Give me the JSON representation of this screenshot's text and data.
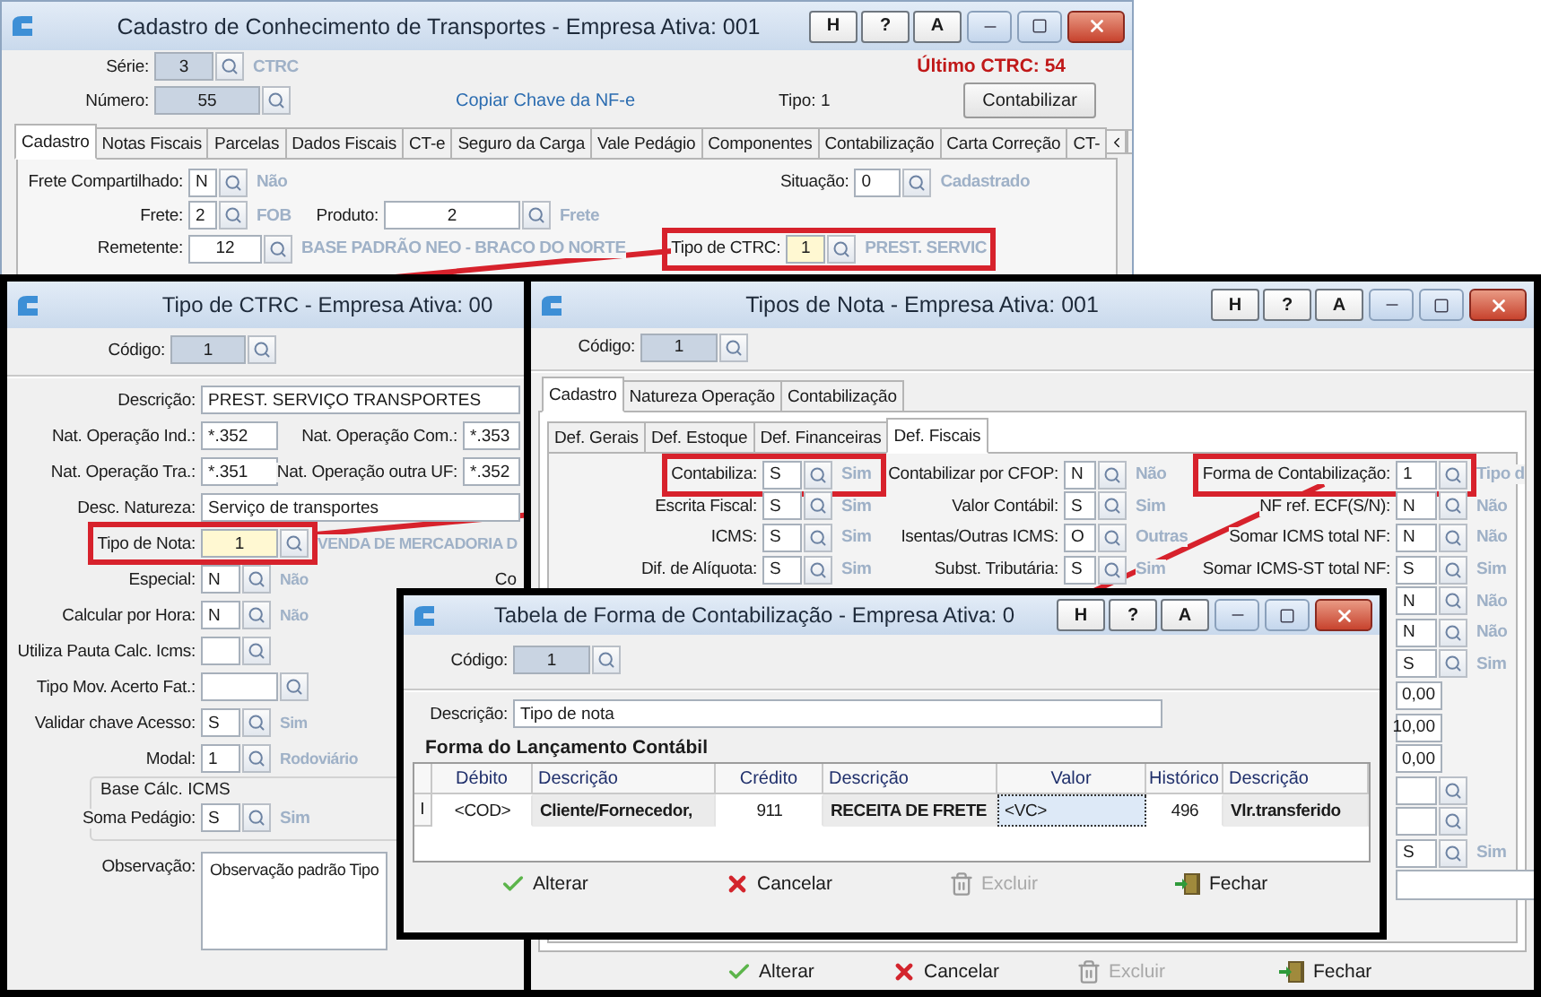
{
  "ctrc_window": {
    "title": "Cadastro de Conhecimento de Transportes - Empresa Ativa: 001",
    "title_buttons": [
      "H",
      "?",
      "A"
    ],
    "serie": {
      "label": "Série:",
      "value": "3",
      "hint": "CTRC"
    },
    "numero": {
      "label": "Número:",
      "value": "55"
    },
    "copy_link": "Copiar Chave da NF-e",
    "tipo": "Tipo: 1",
    "last_ctrc": "Último CTRC: 54",
    "contabilizar_button": "Contabilizar",
    "tabs": [
      {
        "label": "Cadastro",
        "selected": true
      },
      {
        "label": "Notas Fiscais",
        "selected": false
      },
      {
        "label": "Parcelas",
        "selected": false
      },
      {
        "label": "Dados Fiscais",
        "selected": false
      },
      {
        "label": "CT-e",
        "selected": false
      },
      {
        "label": "Seguro da Carga",
        "selected": false
      },
      {
        "label": "Vale Pedágio",
        "selected": false
      },
      {
        "label": "Componentes",
        "selected": false
      },
      {
        "label": "Contabilização",
        "selected": false
      },
      {
        "label": "Carta Correção",
        "selected": false
      },
      {
        "label": "CT-",
        "selected": false
      }
    ],
    "fields": [
      {
        "label": "Frete Compartilhado:",
        "value": "N",
        "hint": "Não",
        "focused": false,
        "highlighted": false
      },
      {
        "label": "Situação:",
        "value": "0",
        "hint": "Cadastrado",
        "focused": false,
        "highlighted": false
      },
      {
        "label": "Frete:",
        "value": "2",
        "hint": "FOB",
        "focused": false,
        "highlighted": false
      },
      {
        "label": "Produto:",
        "value": "2",
        "hint": "Frete",
        "focused": false,
        "highlighted": false
      },
      {
        "label": "Remetente:",
        "value": "12",
        "hint": "BASE PADRÃO NEO - BRACO DO NORTE",
        "focused": false,
        "highlighted": false
      },
      {
        "label": "Tipo de CTRC:",
        "value": "1",
        "hint": "PREST. SERVIC",
        "focused": true,
        "highlighted": true
      }
    ]
  },
  "tipo_ctrc_window": {
    "title": "Tipo de CTRC - Empresa Ativa: 00",
    "code": {
      "label": "Código:",
      "value": "1"
    },
    "fields": [
      {
        "kind": "text",
        "label": "Descrição:",
        "value": "PREST. SERVIÇO TRANSPORTES"
      },
      {
        "kind": "pair",
        "items": [
          {
            "label": "Nat. Operação Ind.:",
            "value": "*.352"
          },
          {
            "label": "Nat. Operação Com.:",
            "value": "*.353"
          }
        ]
      },
      {
        "kind": "pair",
        "items": [
          {
            "label": "Nat. Operação Tra.:",
            "value": "*.351"
          },
          {
            "label": "Nat. Operação outra UF:",
            "value": "*.352"
          }
        ]
      },
      {
        "kind": "text",
        "label": "Desc. Natureza:",
        "value": "Serviço de transportes"
      },
      {
        "kind": "wide_lookup",
        "label": "Tipo de Nota:",
        "value": "1",
        "hint": "VENDA DE MERCADORIA D",
        "focused": true,
        "highlighted": true
      },
      {
        "kind": "lookup",
        "label": "Especial:",
        "value": "N",
        "hint": "Não",
        "focused": false,
        "highlighted": false,
        "side_label": "Co"
      },
      {
        "kind": "lookup",
        "label": "Calcular por Hora:",
        "value": "N",
        "hint": "Não",
        "focused": false,
        "highlighted": false
      },
      {
        "kind": "lookup",
        "label": "Utiliza Pauta Calc. Icms:",
        "focused": false,
        "highlighted": false
      },
      {
        "kind": "wide_lookup",
        "label": "Tipo Mov. Acerto Fat.:",
        "focused": false,
        "highlighted": false
      },
      {
        "kind": "lookup",
        "label": "Validar chave Acesso:",
        "value": "S",
        "hint": "Sim",
        "focused": false,
        "highlighted": false
      },
      {
        "kind": "lookup",
        "label": "Modal:",
        "value": "1",
        "hint": "Rodoviário",
        "focused": false,
        "highlighted": false
      },
      {
        "kind": "group",
        "title": "Base Cálc. ICMS",
        "field": {
          "label": "Soma Pedágio:",
          "value": "S",
          "hint": "Sim",
          "focused": false,
          "highlighted": false
        }
      },
      {
        "kind": "memo",
        "label": "Observação:",
        "value": "Observação padrão Tipo"
      }
    ]
  },
  "tipos_nota_window": {
    "title": "Tipos de Nota - Empresa Ativa: 001",
    "title_buttons": [
      "H",
      "?",
      "A"
    ],
    "code": {
      "label": "Código:",
      "value": "1"
    },
    "tabs": [
      {
        "label": "Cadastro",
        "selected": true
      },
      {
        "label": "Natureza Operação",
        "selected": false
      },
      {
        "label": "Contabilização",
        "selected": false
      }
    ],
    "subtabs": [
      {
        "label": "Def. Gerais",
        "selected": false
      },
      {
        "label": "Def. Estoque",
        "selected": false
      },
      {
        "label": "Def. Financeiras",
        "selected": false
      },
      {
        "label": "Def. Fiscais",
        "selected": true
      }
    ],
    "columns": [
      [
        {
          "kind": "lookup",
          "label": "Contabiliza:",
          "value": "S",
          "hint": "Sim",
          "highlighted": true
        },
        {
          "kind": "lookup",
          "label": "Escrita Fiscal:",
          "value": "S",
          "hint": "Sim",
          "highlighted": false
        },
        {
          "kind": "lookup",
          "label": "ICMS:",
          "value": "S",
          "hint": "Sim",
          "highlighted": false
        },
        {
          "kind": "lookup",
          "label": "Dif. de Alíquota:",
          "value": "S",
          "hint": "Sim",
          "highlighted": false
        }
      ],
      [
        {
          "kind": "lookup",
          "label": "Contabilizar por CFOP:",
          "value": "N",
          "hint": "Não",
          "highlighted": false
        },
        {
          "kind": "lookup",
          "label": "Valor Contábil:",
          "value": "S",
          "hint": "Sim",
          "highlighted": false
        },
        {
          "kind": "lookup",
          "label": "Isentas/Outras ICMS:",
          "value": "O",
          "hint": "Outras",
          "highlighted": false
        },
        {
          "kind": "lookup",
          "label": "Subst. Tributária:",
          "value": "S",
          "hint": "Sim",
          "highlighted": false
        }
      ],
      [
        {
          "kind": "lookup",
          "label": "Forma de Contabilização:",
          "value": "1",
          "hint": "Tipo d",
          "highlighted": true
        },
        {
          "kind": "lookup",
          "label": "NF ref. ECF(S/N):",
          "value": "N",
          "hint": "Não",
          "highlighted": false
        },
        {
          "kind": "lookup",
          "label": "Somar ICMS total NF:",
          "value": "N",
          "hint": "Não",
          "highlighted": false
        },
        {
          "kind": "lookup",
          "label": "Somar ICMS-ST total NF:",
          "value": "S",
          "hint": "Sim",
          "highlighted": false
        },
        {
          "kind": "lookup",
          "value": "N",
          "hint": "Não",
          "highlighted": false
        },
        {
          "kind": "lookup",
          "value": "N",
          "hint": "Não",
          "highlighted": false
        },
        {
          "kind": "lookup",
          "value": "S",
          "hint": "Sim",
          "highlighted": false
        },
        {
          "kind": "number",
          "value": "0,00"
        },
        {
          "kind": "number",
          "value": "10,00"
        },
        {
          "kind": "number",
          "value": "0,00"
        },
        {
          "kind": "lookup",
          "highlighted": false
        },
        {
          "kind": "lookup",
          "highlighted": false
        },
        {
          "kind": "lookup",
          "value": "S",
          "hint": "Sim",
          "highlighted": false
        },
        {
          "kind": "memo"
        }
      ]
    ],
    "buttons": [
      {
        "kind": "confirm",
        "label": "Alterar",
        "disabled": false
      },
      {
        "kind": "cancel",
        "label": "Cancelar",
        "disabled": false
      },
      {
        "kind": "delete",
        "label": "Excluir",
        "disabled": true
      },
      {
        "kind": "close",
        "label": "Fechar",
        "disabled": false
      }
    ]
  },
  "forma_window": {
    "title": "Tabela de Forma de Contabilização - Empresa Ativa: 0",
    "title_buttons": [
      "H",
      "?",
      "A"
    ],
    "code": {
      "label": "Código:",
      "value": "1"
    },
    "description": {
      "label": "Descrição:",
      "value": "Tipo de nota"
    },
    "section_title": "Forma do Lançamento Contábil",
    "columns": [
      {
        "label": "Débito",
        "kind": "code"
      },
      {
        "label": "Descrição",
        "kind": "description"
      },
      {
        "label": "Crédito",
        "kind": "code"
      },
      {
        "label": "Descrição",
        "kind": "description"
      },
      {
        "label": "Valor",
        "kind": "value"
      },
      {
        "label": "Histórico",
        "kind": "code"
      },
      {
        "label": "Descrição",
        "kind": "description"
      }
    ],
    "rows": [
      {
        "indicator": "I",
        "cells": [
          {
            "text": "<COD>",
            "focused": false
          },
          {
            "text": "Cliente/Fornecedor,",
            "focused": false
          },
          {
            "text": "911",
            "focused": false
          },
          {
            "text": "RECEITA DE FRETE",
            "focused": false
          },
          {
            "text": "<VC>",
            "focused": true
          },
          {
            "text": "496",
            "focused": false
          },
          {
            "text": "Vlr.transferido",
            "focused": false
          }
        ]
      }
    ],
    "buttons": [
      {
        "kind": "confirm",
        "label": "Alterar",
        "disabled": false
      },
      {
        "kind": "cancel",
        "label": "Cancelar",
        "disabled": false
      },
      {
        "kind": "delete",
        "label": "Excluir",
        "disabled": true
      },
      {
        "kind": "close",
        "label": "Fechar",
        "disabled": false
      }
    ]
  }
}
